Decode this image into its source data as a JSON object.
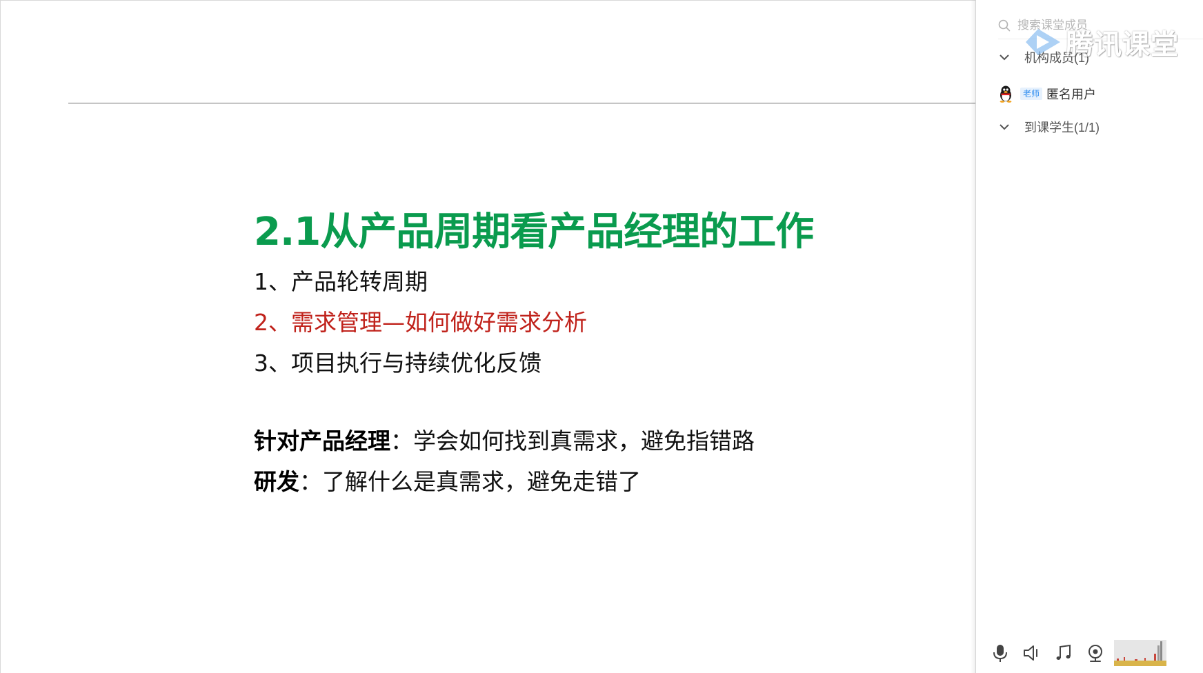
{
  "slide": {
    "title": "2.1从产品周期看产品经理的工作",
    "list": [
      {
        "text": "1、产品轮转周期",
        "highlighted": false
      },
      {
        "text": "2、需求管理—如何做好需求分析",
        "highlighted": true
      },
      {
        "text": "3、项目执行与持续优化反馈",
        "highlighted": false
      }
    ],
    "notes": [
      {
        "bold": "针对产品经理",
        "text": "：学会如何找到真需求，避免指错路"
      },
      {
        "bold": "研发",
        "text": "：了解什么是真需求，避免走错了"
      }
    ],
    "colors": {
      "title": "#0a9b4e",
      "highlight": "#c0221b"
    }
  },
  "panel": {
    "search": {
      "placeholder": "搜索课堂成员",
      "value": ""
    },
    "watermark": {
      "text": "腾讯课堂"
    },
    "groups": [
      {
        "label": "机构成员(1)",
        "expanded": true
      },
      {
        "label": "到课学生(1/1)",
        "expanded": true
      }
    ],
    "members": [
      {
        "role": "老师",
        "name": "匿名用户",
        "avatar": "qq-penguin-icon"
      }
    ],
    "controls": [
      {
        "name": "microphone-icon"
      },
      {
        "name": "speaker-icon"
      },
      {
        "name": "music-icon"
      },
      {
        "name": "camera-icon"
      }
    ]
  }
}
